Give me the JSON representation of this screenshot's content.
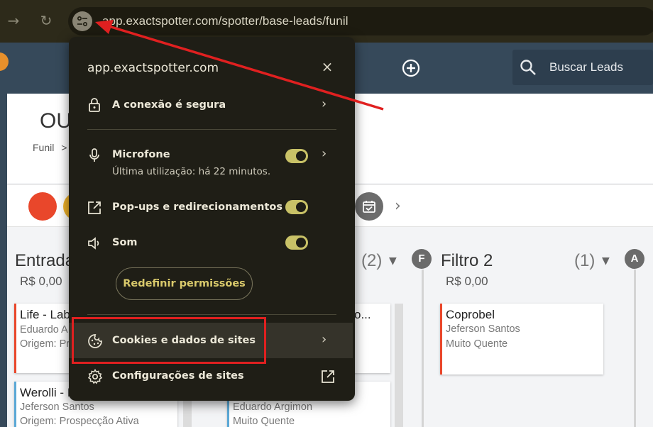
{
  "browser": {
    "url": "app.exactspotter.com/spotter/base-leads/funil",
    "forward_glyph": "→",
    "reload_glyph": "↻"
  },
  "app": {
    "search_placeholder": "Buscar Leads",
    "page_title": "OU",
    "breadcrumb_root": "Funil",
    "breadcrumb_sep": ">"
  },
  "columns": [
    {
      "title": "Entrada",
      "amount": "R$ 0,00"
    },
    {
      "count": "(2)",
      "badge": "F"
    },
    {
      "title": "Filtro 2",
      "amount": "R$ 0,00",
      "count": "(1)",
      "badge": "A"
    }
  ],
  "cards": [
    {
      "title": "Life - Lab",
      "line1": "Eduardo A",
      "line2": "Origem: Pr"
    },
    {
      "title": "Werolli - I",
      "line1": "Jeferson Santos",
      "line2": "Origem: Prospecção Ativa"
    },
    {
      "title": "o..."
    },
    {
      "line1": "Eduardo Argimon",
      "line2": "Muito Quente"
    },
    {
      "title": "Coprobel",
      "line1": "Jeferson Santos",
      "line2": "Muito Quente"
    }
  ],
  "popup": {
    "domain": "app.exactspotter.com",
    "close_glyph": "×",
    "connection": "A conexão é segura",
    "microphone": {
      "label": "Microfone",
      "sub": "Última utilização: há 22 minutos.",
      "enabled": true
    },
    "popups": {
      "label": "Pop-ups e redirecionamentos",
      "enabled": true
    },
    "sound": {
      "label": "Som",
      "enabled": true
    },
    "reset": "Redefinir permissões",
    "cookies": "Cookies e dados de sites",
    "site_settings": "Configurações de sites",
    "chevron": "›"
  },
  "colors": {
    "toolbar": "#2d2a1a",
    "popup_bg": "#1f1e16",
    "toggle_on": "#c9c267",
    "app_header": "#36495a",
    "annotation": "#e02020",
    "card_hot": "#e9472b",
    "card_cool": "#5aa8d6"
  }
}
